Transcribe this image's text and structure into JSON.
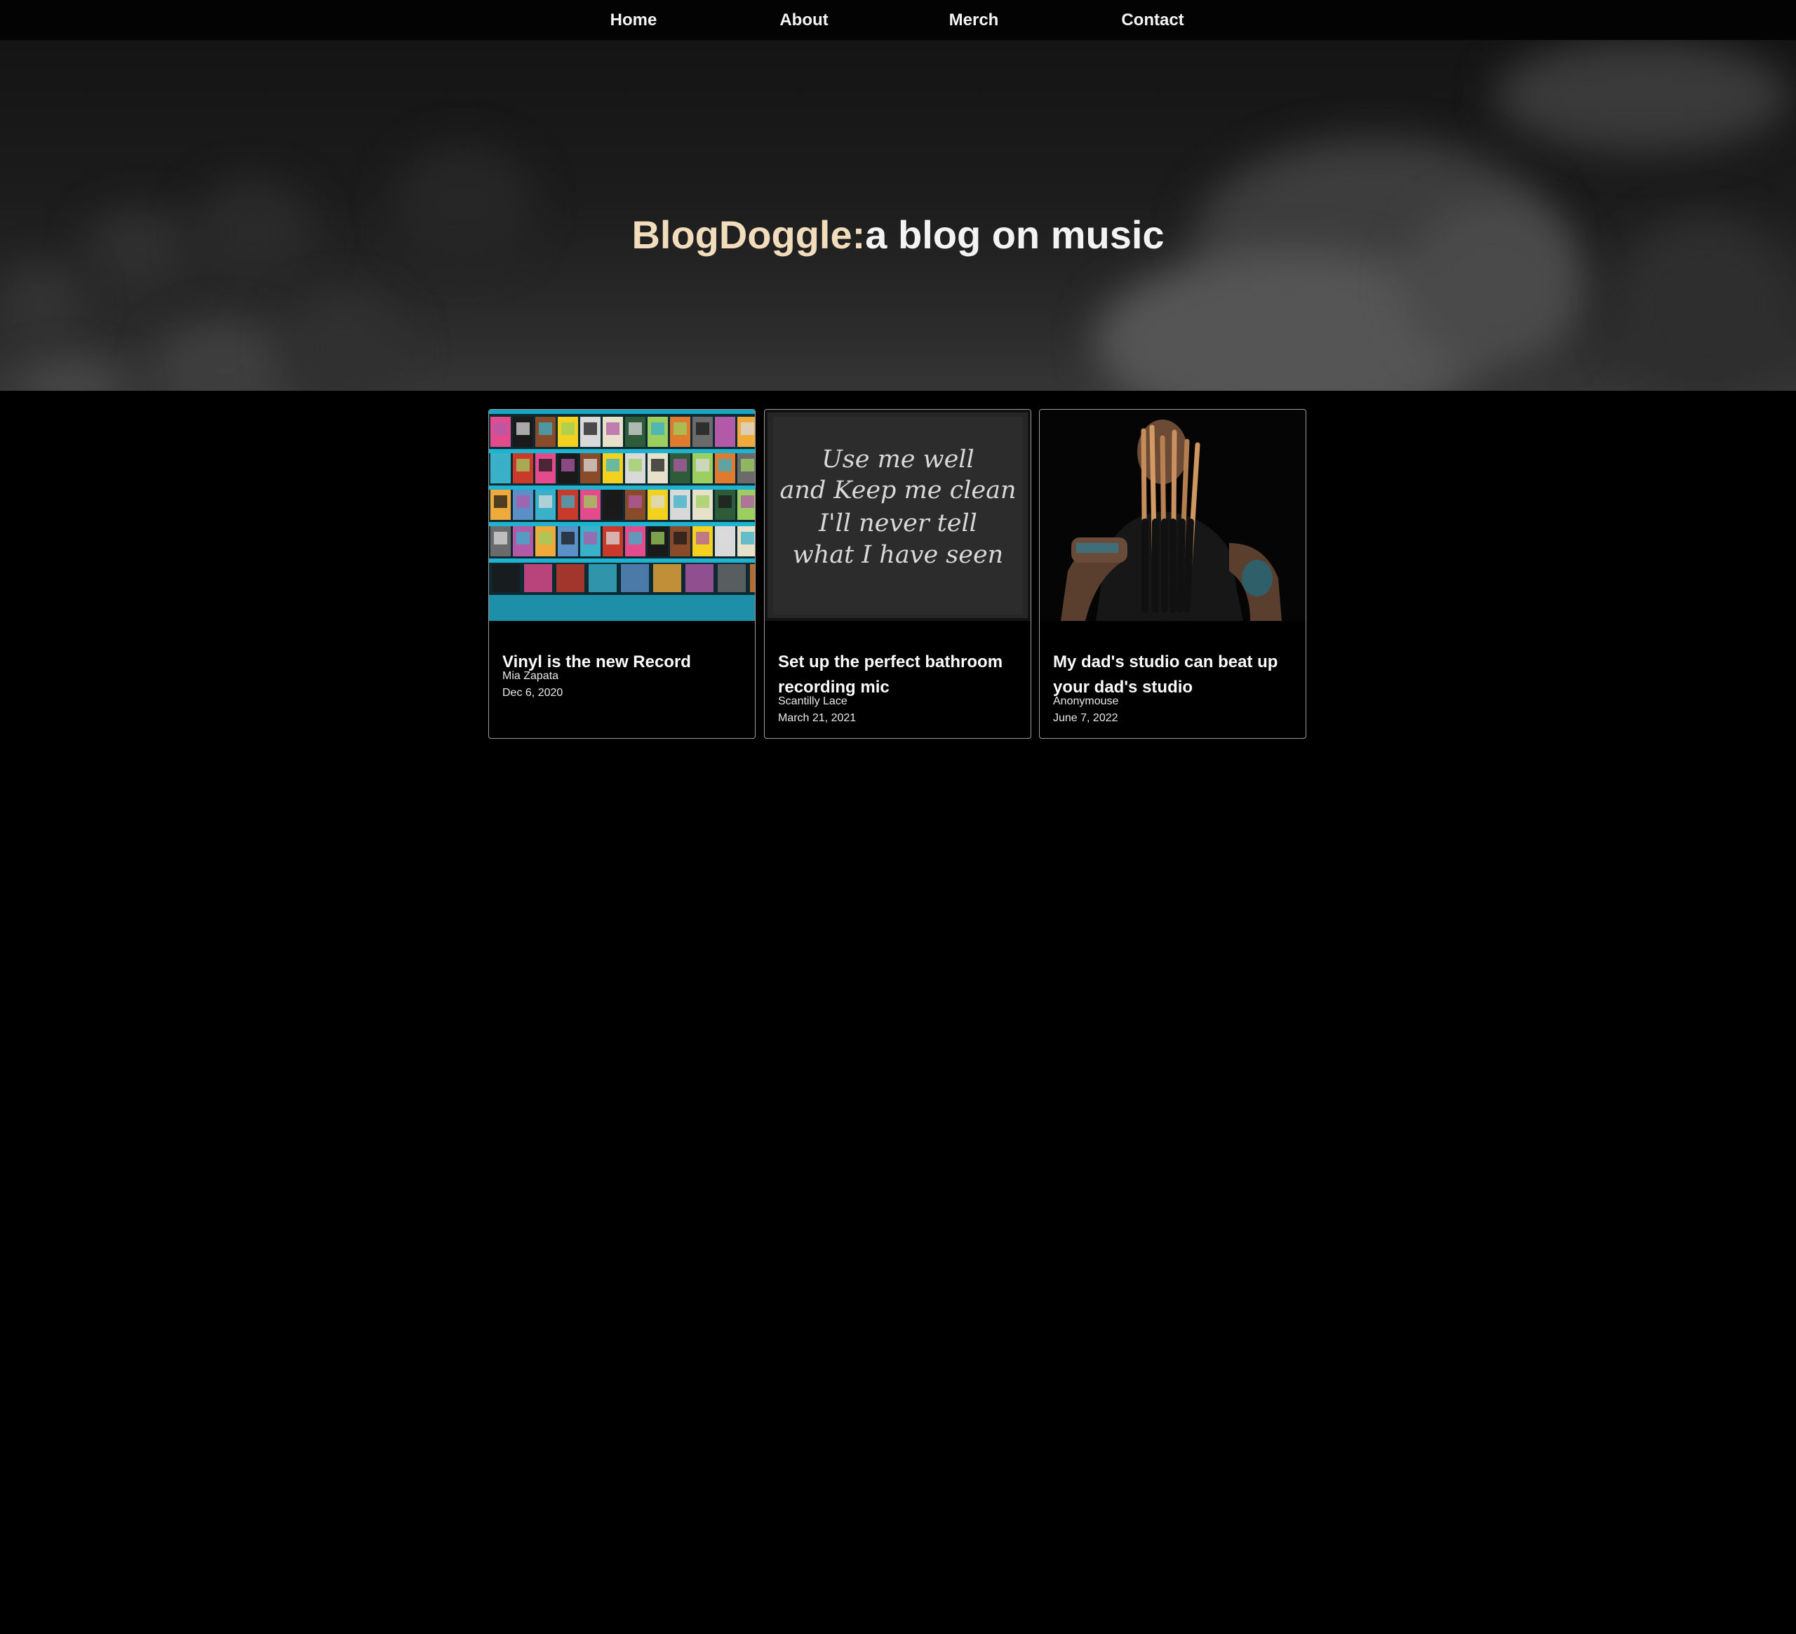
{
  "nav": {
    "items": [
      {
        "label": "Home"
      },
      {
        "label": "About"
      },
      {
        "label": "Merch"
      },
      {
        "label": "Contact"
      }
    ]
  },
  "hero": {
    "brand": "BlogDoggle:",
    "tagline": "a blog on music"
  },
  "posts": [
    {
      "title": "Vinyl is the new Record",
      "author": "Mia Zapata",
      "date": "Dec 6, 2020",
      "image": "vinyl-record-shelves"
    },
    {
      "title": "Set up the perfect bathroom recording mic",
      "author": "Scantilly Lace",
      "date": "March 21, 2021",
      "image": "chalkboard-text",
      "image_text": [
        "Use me well",
        "and Keep me clean",
        "I'll never tell",
        "what I have seen"
      ]
    },
    {
      "title": "My dad's studio can beat up your dad's studio",
      "author": "Anonymouse",
      "date": "June 7, 2022",
      "image": "drummer-holding-drumsticks"
    }
  ],
  "colors": {
    "background": "#000000",
    "brand": "#f1dcbb",
    "card_border": "#9c9c9c"
  }
}
